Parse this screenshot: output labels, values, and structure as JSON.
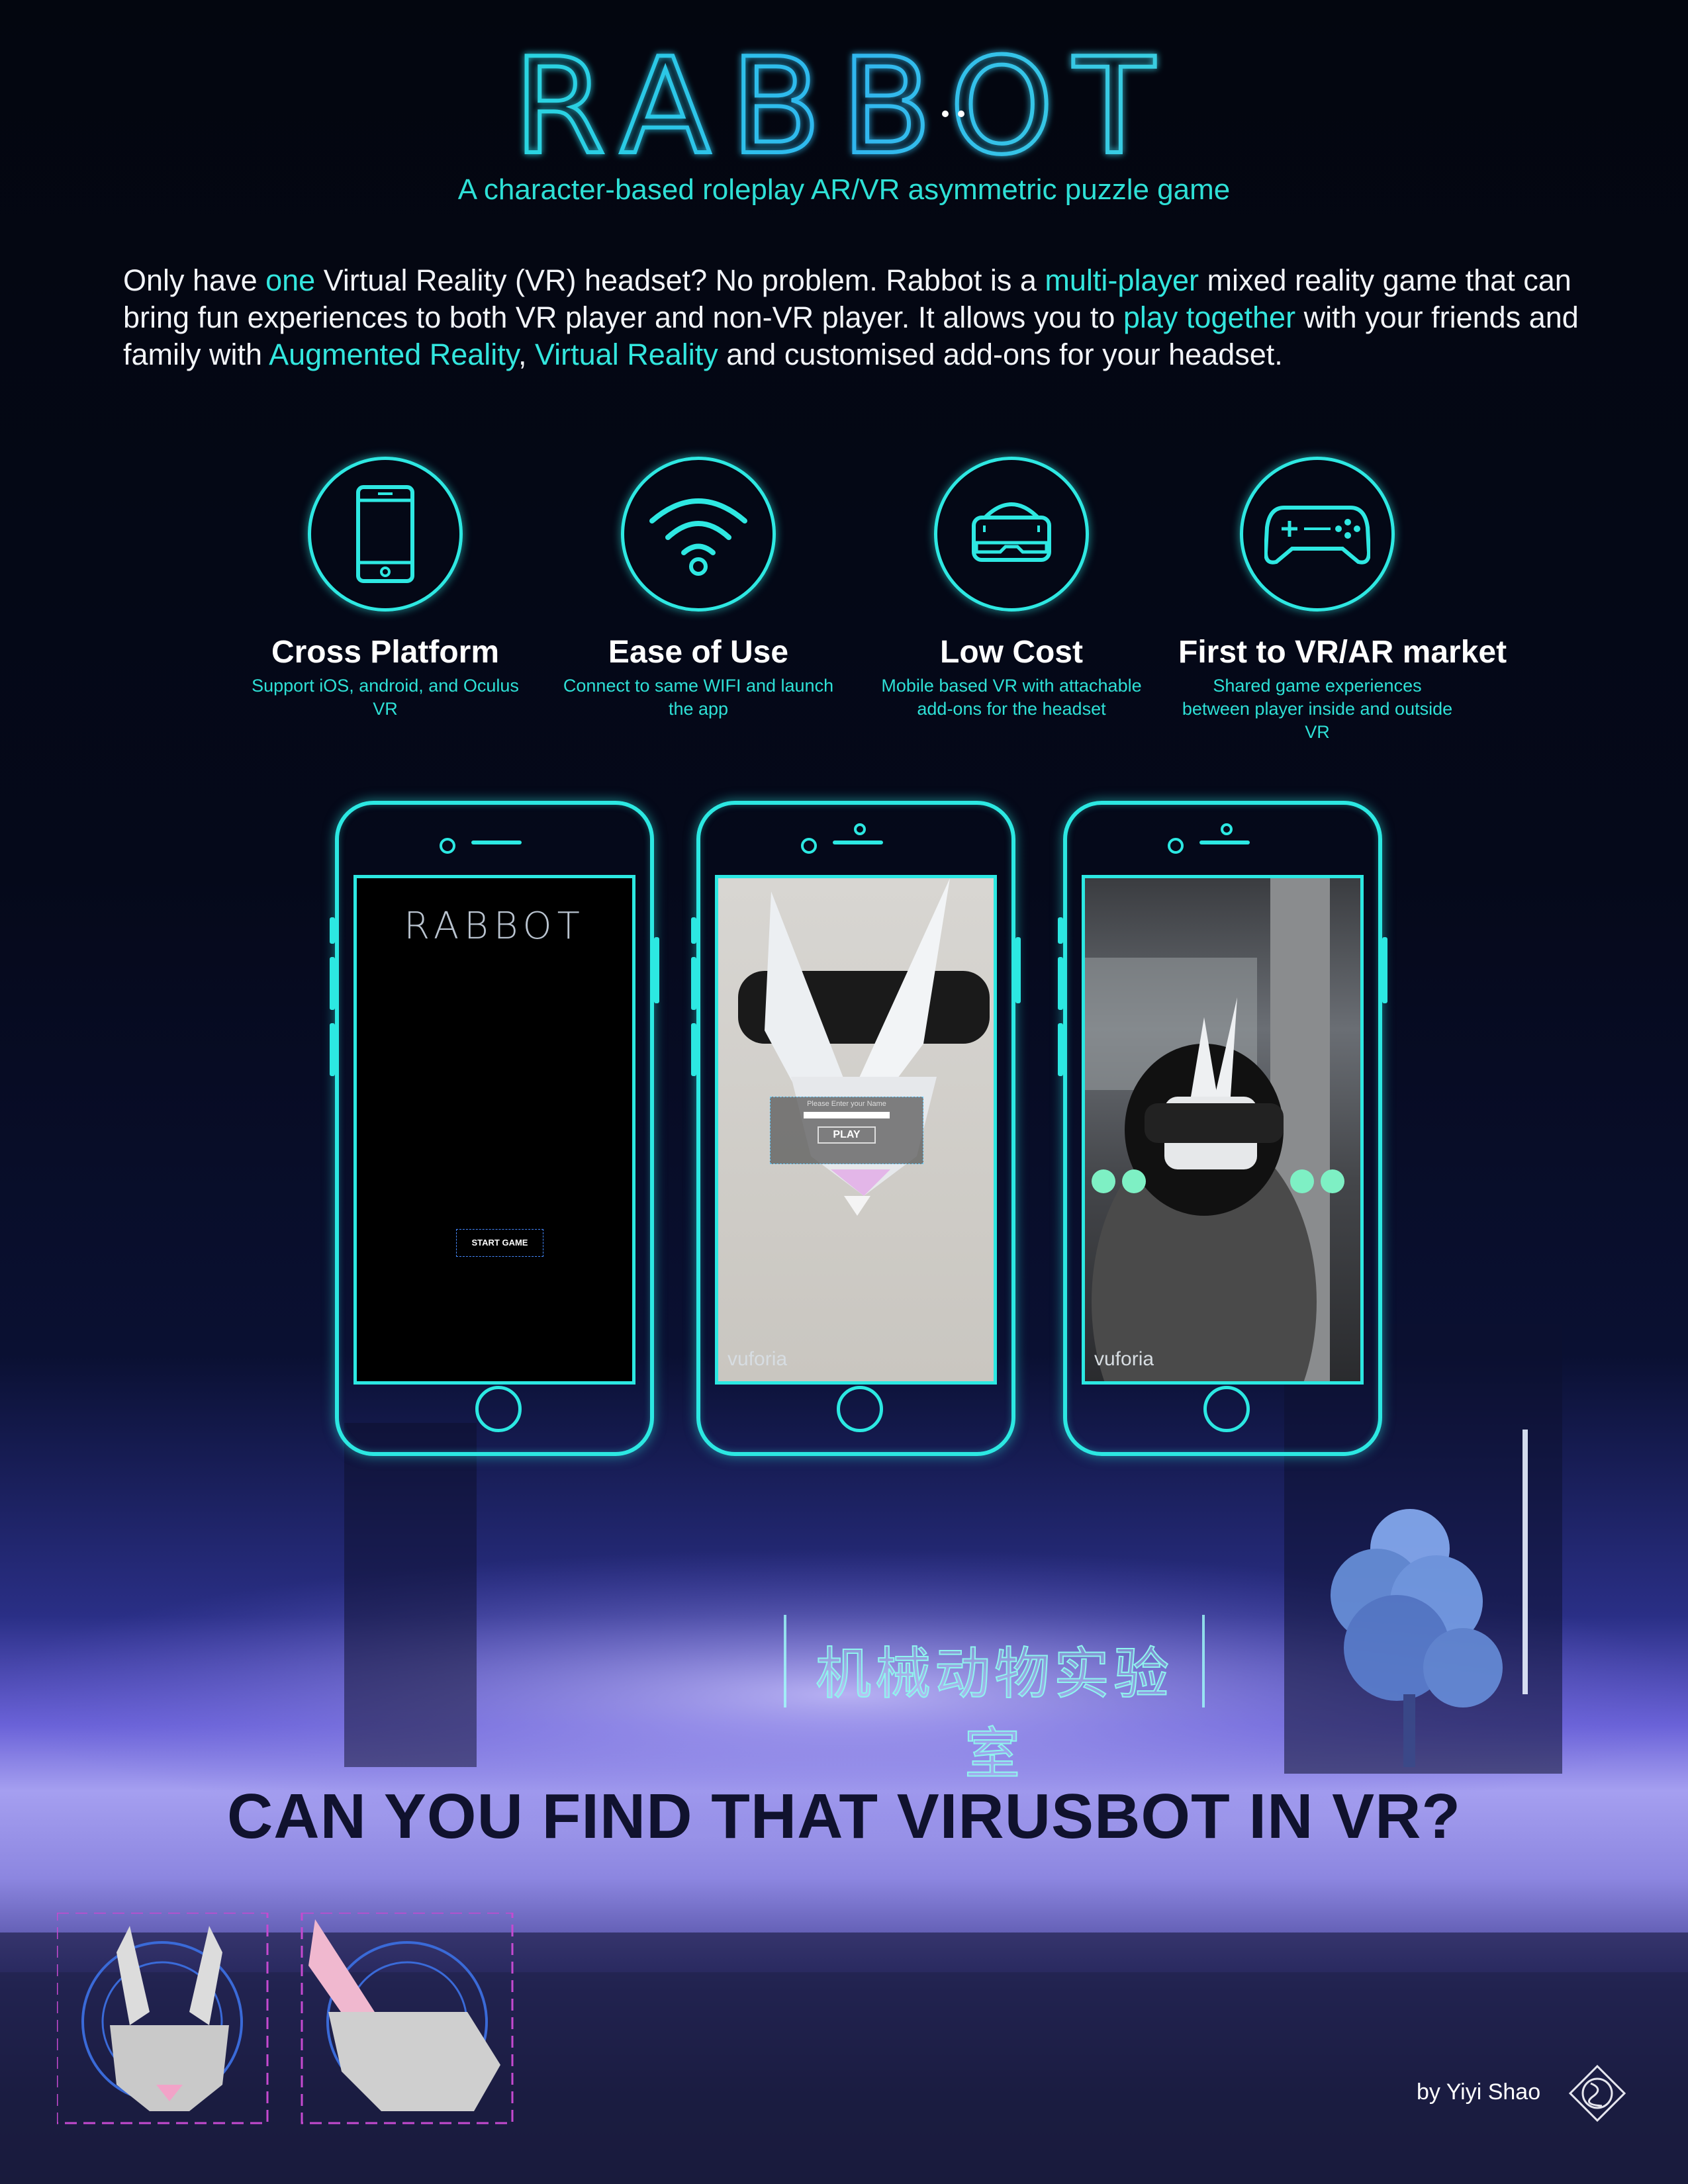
{
  "title": "RABBOT",
  "subtitle": "A character-based roleplay AR/VR asymmetric puzzle game",
  "intro": {
    "p1": "Only have ",
    "h1": "one",
    "p2": " Virtual Reality (VR) headset? No problem. Rabbot is a ",
    "h2": "multi-player",
    "p3": " mixed reality game that can bring fun experiences to both VR player and non-VR player. It allows you to ",
    "h3": "play together",
    "p4": " with your friends and family with ",
    "h4": "Augmented Reality",
    "p5": ", ",
    "h5": "Virtual Reality",
    "p6": " and customised add-ons for your headset."
  },
  "features": [
    {
      "icon": "smartphone-icon",
      "title": "Cross Platform",
      "desc": "Support iOS, android, and Oculus VR"
    },
    {
      "icon": "wifi-icon",
      "title": "Ease of Use",
      "desc": "Connect to same WIFI and launch the app"
    },
    {
      "icon": "vr-headset-icon",
      "title": "Low Cost",
      "desc": "Mobile based VR  with attachable add-ons for the headset"
    },
    {
      "icon": "gamepad-icon",
      "title": "First to VR/AR market",
      "desc": "Shared game experiences between player inside and outside VR"
    }
  ],
  "phones": [
    {
      "logo": "RABBOT",
      "button": "START GAME"
    },
    {
      "prompt": "Please Enter your Name",
      "button": "PLAY",
      "watermark": "vuforia"
    },
    {
      "watermark": "vuforia"
    }
  ],
  "sign": "机械动物实验室",
  "tagline": "CAN YOU FIND THAT VIRUSBOT IN VR?",
  "author": "by Yiyi Shao",
  "colors": {
    "accent": "#2ee8e2",
    "background": "#03060f",
    "glow": "#6a62d8"
  }
}
